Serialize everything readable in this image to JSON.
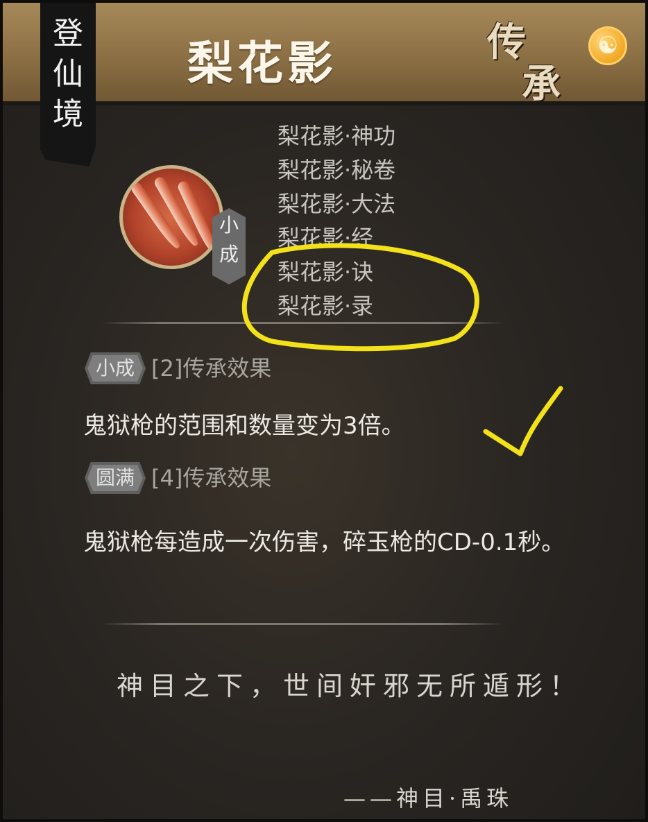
{
  "realm": {
    "label": "登\n仙\n境"
  },
  "skill": {
    "title": "梨花影",
    "tier_badge": "小\n成",
    "inherit_mark": [
      "传",
      "承"
    ],
    "variants": [
      "梨花影·神功",
      "梨花影·秘卷",
      "梨花影·大法",
      "梨花影·经",
      "梨花影·诀",
      "梨花影·录"
    ]
  },
  "effects": [
    {
      "badge": "小成",
      "label": "[2]传承效果",
      "description": "鬼狱枪的范围和数量变为3倍。"
    },
    {
      "badge": "圆满",
      "label": "[4]传承效果",
      "description": "鬼狱枪每造成一次伤害，碎玉枪的CD-0.1秒。"
    }
  ],
  "quote": {
    "text": "神目之下，世间奸邪无所遁形！",
    "source": "——神目·禹珠"
  },
  "icons": {
    "emblem": "yin-yang-icon",
    "emblem_glyph": "☯",
    "skill": "flying-daggers-skill-icon"
  },
  "colors": {
    "header_gold": "#a78a5a",
    "panel_dark": "#2a2622",
    "annotation_yellow": "#f3e11a",
    "emblem_orange": "#f0a41e"
  }
}
